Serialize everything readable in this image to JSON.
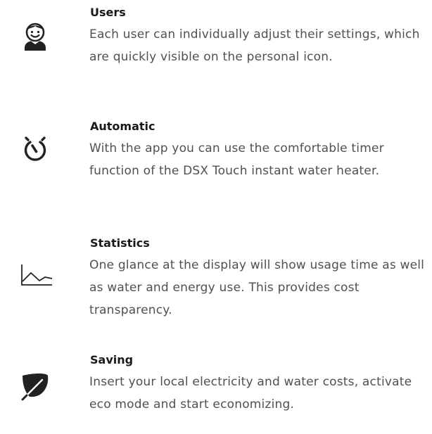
{
  "features": [
    {
      "icon": "user-avatar-icon",
      "title": "Users",
      "description": "Each user can individually adjust their settings, which are quickly visible on the personal icon."
    },
    {
      "icon": "timer-icon",
      "title": "Automatic",
      "description": "With the app you can use the comfortable timer function of the DSX Touch instant water heater."
    },
    {
      "icon": "line-chart-icon",
      "title": "Statistics",
      "description": "One glance at the display will show usage time as well as water and energy use. This provides cost transparency."
    },
    {
      "icon": "leaf-icon",
      "title": "Saving",
      "description": "Insert your local electricity and water costs, activate eco mode and start economizing."
    }
  ],
  "colors": {
    "icon": "#222222",
    "title": "#1a1a1a",
    "text": "#505050",
    "background": "#ffffff"
  }
}
